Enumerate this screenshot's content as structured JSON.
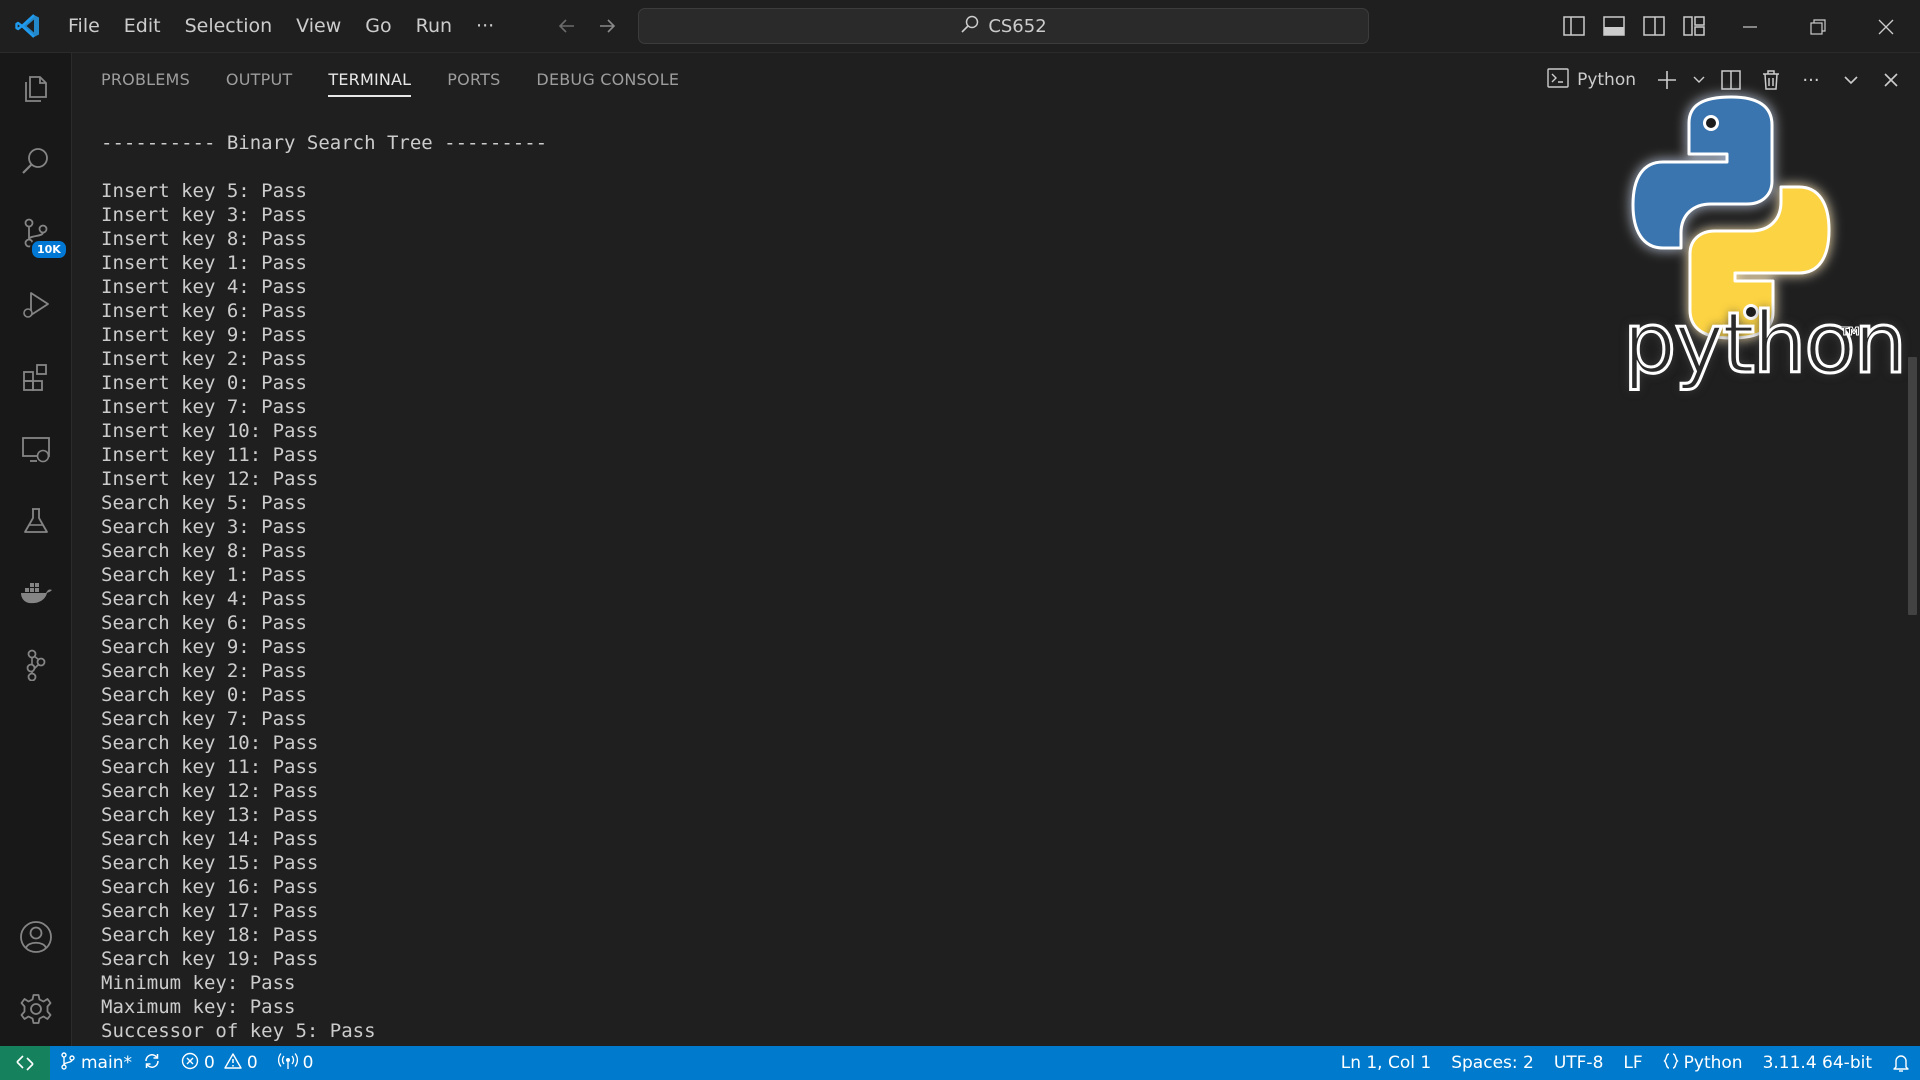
{
  "window": {
    "menu": [
      "File",
      "Edit",
      "Selection",
      "View",
      "Go",
      "Run"
    ],
    "more_label": "···",
    "search_text": "CS652"
  },
  "activity_bar": {
    "source_control_badge": "10K"
  },
  "panel": {
    "tabs": [
      "PROBLEMS",
      "OUTPUT",
      "TERMINAL",
      "PORTS",
      "DEBUG CONSOLE"
    ],
    "active_tab": "TERMINAL",
    "terminal_name": "Python",
    "more_label": "···"
  },
  "terminal": {
    "header": "---------- Binary Search Tree ---------",
    "lines": [
      "Insert key 5: Pass",
      "Insert key 3: Pass",
      "Insert key 8: Pass",
      "Insert key 1: Pass",
      "Insert key 4: Pass",
      "Insert key 6: Pass",
      "Insert key 9: Pass",
      "Insert key 2: Pass",
      "Insert key 0: Pass",
      "Insert key 7: Pass",
      "Insert key 10: Pass",
      "Insert key 11: Pass",
      "Insert key 12: Pass",
      "Search key 5: Pass",
      "Search key 3: Pass",
      "Search key 8: Pass",
      "Search key 1: Pass",
      "Search key 4: Pass",
      "Search key 6: Pass",
      "Search key 9: Pass",
      "Search key 2: Pass",
      "Search key 0: Pass",
      "Search key 7: Pass",
      "Search key 10: Pass",
      "Search key 11: Pass",
      "Search key 12: Pass",
      "Search key 13: Pass",
      "Search key 14: Pass",
      "Search key 15: Pass",
      "Search key 16: Pass",
      "Search key 17: Pass",
      "Search key 18: Pass",
      "Search key 19: Pass",
      "Minimum key: Pass",
      "Maximum key: Pass",
      "Successor of key 5: Pass"
    ]
  },
  "overlay": {
    "wordmark": "python",
    "trademark": "TM"
  },
  "status_bar": {
    "branch": "main*",
    "errors": "0",
    "warnings": "0",
    "ports": "0",
    "position": "Ln 1, Col 1",
    "spaces": "Spaces: 2",
    "encoding": "UTF-8",
    "eol": "LF",
    "language": "Python",
    "interpreter": "3.11.4 64-bit"
  },
  "colors": {
    "accent": "#007acc",
    "remote": "#16825d",
    "badge": "#0078d4",
    "python_blue": "#3a75b0",
    "python_yellow": "#fcd343"
  }
}
